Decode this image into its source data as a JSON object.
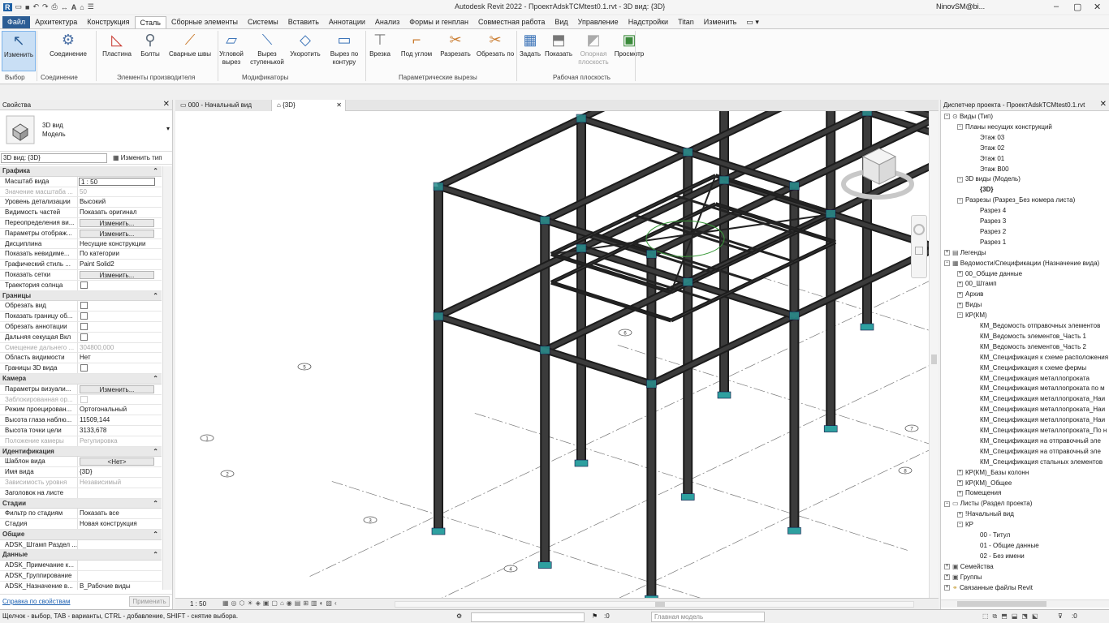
{
  "window": {
    "title": "Autodesk Revit 2022 - ПроектAdskTCMtest0.1.rvt - 3D вид: {3D}",
    "user": "NinovSM@bi..."
  },
  "tabs": [
    "Файл",
    "Архитектура",
    "Конструкция",
    "Сталь",
    "Сборные элементы",
    "Системы",
    "Вставить",
    "Аннотации",
    "Анализ",
    "Формы и генплан",
    "Совместная работа",
    "Вид",
    "Управление",
    "Надстройки",
    "Titan",
    "Изменить"
  ],
  "ribbon": {
    "buttons": [
      "Изменить",
      "Соединение",
      "Пластина",
      "Болты",
      "Сварные швы",
      "Угловой вырез",
      "Вырез ступенькой",
      "Укоротить",
      "Вырез по контуру",
      "Врезка",
      "Под углом",
      "Разрезать",
      "Обрезать по",
      "Задать",
      "Показать",
      "Опорная плоскость",
      "Просмотр"
    ],
    "panels": [
      "Выбор",
      "Соединение",
      "Элементы производителя",
      "Модификаторы",
      "Параметрические вырезы",
      "Рабочая плоскость"
    ]
  },
  "properties": {
    "title": "Свойства",
    "type_name": "3D вид",
    "type_family": "Модель",
    "selector": "3D вид: {3D}",
    "edit_type": "Изменить тип",
    "sections": [
      {
        "name": "Графика",
        "rows": [
          [
            "Масштаб вида",
            "1 : 50"
          ],
          [
            "Значение масштаба ...",
            "50"
          ],
          [
            "Уровень детализации",
            "Высокий"
          ],
          [
            "Видимость частей",
            "Показать оригинал"
          ],
          [
            "Переопределения ви...",
            "Изменить..."
          ],
          [
            "Параметры отображ...",
            "Изменить..."
          ],
          [
            "Дисциплина",
            "Несущие конструкции"
          ],
          [
            "Показать невидиме...",
            "По категории"
          ],
          [
            "Графический стиль ...",
            "Paint Solid2"
          ],
          [
            "Показать сетки",
            "Изменить..."
          ],
          [
            "Траектория солнца",
            ""
          ]
        ]
      },
      {
        "name": "Границы",
        "rows": [
          [
            "Обрезать вид",
            ""
          ],
          [
            "Показать границу об...",
            ""
          ],
          [
            "Обрезать аннотации",
            ""
          ],
          [
            "Дальняя секущая Вкл",
            ""
          ],
          [
            "Смещение дальнего ...",
            "304800,000"
          ],
          [
            "Область видимости",
            "Нет"
          ],
          [
            "Границы 3D вида",
            ""
          ]
        ]
      },
      {
        "name": "Камера",
        "rows": [
          [
            "Параметры визуали...",
            "Изменить..."
          ],
          [
            "Заблокированная ор...",
            ""
          ],
          [
            "Режим проецирован...",
            "Ортогональный"
          ],
          [
            "Высота глаза наблю...",
            "11509,144"
          ],
          [
            "Высота точки цели",
            "3133,678"
          ],
          [
            "Положение камеры",
            "Регулировка"
          ]
        ]
      },
      {
        "name": "Идентификация",
        "rows": [
          [
            "Шаблон вида",
            "<Нет>"
          ],
          [
            "Имя вида",
            "{3D}"
          ],
          [
            "Зависимость уровня",
            "Независимый"
          ],
          [
            "Заголовок на листе",
            ""
          ]
        ]
      },
      {
        "name": "Стадии",
        "rows": [
          [
            "Фильтр по стадиям",
            "Показать все"
          ],
          [
            "Стадия",
            "Новая конструкция"
          ]
        ]
      },
      {
        "name": "Общие",
        "rows": [
          [
            "ADSK_Штамп Раздел ...",
            ""
          ]
        ]
      },
      {
        "name": "Данные",
        "rows": [
          [
            "ADSK_Примечание к...",
            ""
          ],
          [
            "ADSK_Группирование",
            ""
          ],
          [
            "ADSK_Назначение в...",
            "В_Рабочие виды"
          ]
        ]
      }
    ],
    "help_link": "Справка по свойствам",
    "apply": "Применить"
  },
  "view_tabs": [
    "000 - Начальный вид",
    "{3D}"
  ],
  "view_scale": "1 : 50",
  "grid_labels": [
    "1",
    "2",
    "3",
    "4",
    "5",
    "6",
    "7",
    "8"
  ],
  "browser": {
    "title": "Диспетчер проекта - ПроектAdskTCMtest0.1.rvt",
    "items": [
      {
        "t": "Виды (Тип)",
        "l": 0
      },
      {
        "t": "Планы несущих конструкций",
        "l": 1
      },
      {
        "t": "Этаж 03",
        "l": 2
      },
      {
        "t": "Этаж 02",
        "l": 2
      },
      {
        "t": "Этаж 01",
        "l": 2
      },
      {
        "t": "Этаж В00",
        "l": 2
      },
      {
        "t": "3D виды (Модель)",
        "l": 1
      },
      {
        "t": "{3D}",
        "l": 2
      },
      {
        "t": "Разрезы (Разрез_Без номера листа)",
        "l": 1
      },
      {
        "t": "Разрез 4",
        "l": 2
      },
      {
        "t": "Разрез 3",
        "l": 2
      },
      {
        "t": "Разрез 2",
        "l": 2
      },
      {
        "t": "Разрез 1",
        "l": 2
      },
      {
        "t": "Легенды",
        "l": 0
      },
      {
        "t": "Ведомости/Спецификации (Назначение вида)",
        "l": 0
      },
      {
        "t": "00_Общие данные",
        "l": 1
      },
      {
        "t": "00_Штамп",
        "l": 1
      },
      {
        "t": "Архив",
        "l": 1
      },
      {
        "t": "Виды",
        "l": 1
      },
      {
        "t": "КР(КМ)",
        "l": 1
      },
      {
        "t": "КМ_Ведомость отправочных элементов",
        "l": 2
      },
      {
        "t": "КМ_Ведомость элементов_Часть 1",
        "l": 2
      },
      {
        "t": "КМ_Ведомость элементов_Часть 2",
        "l": 2
      },
      {
        "t": "КМ_Спецификация к схеме расположения",
        "l": 2
      },
      {
        "t": "КМ_Спецификация к схеме фермы",
        "l": 2
      },
      {
        "t": "КМ_Спецификация металлопроката",
        "l": 2
      },
      {
        "t": "КМ_Спецификация металлопроката по м",
        "l": 2
      },
      {
        "t": "КМ_Спецификация металлопроката_Наи",
        "l": 2
      },
      {
        "t": "КМ_Спецификация металлопроката_Наи",
        "l": 2
      },
      {
        "t": "КМ_Спецификация металлопроката_Наи",
        "l": 2
      },
      {
        "t": "КМ_Спецификация металлопроката_По н",
        "l": 2
      },
      {
        "t": "КМ_Спецификация на отправочный эле",
        "l": 2
      },
      {
        "t": "КМ_Спецификация на отправочный эле",
        "l": 2
      },
      {
        "t": "КМ_Спецификация стальных элементов",
        "l": 2
      },
      {
        "t": "КР(КМ)_Базы колонн",
        "l": 1
      },
      {
        "t": "КР(КМ)_Общее",
        "l": 1
      },
      {
        "t": "Помещения",
        "l": 1
      },
      {
        "t": "Листы (Раздел проекта)",
        "l": 0
      },
      {
        "t": "!Начальный вид",
        "l": 1
      },
      {
        "t": "КР",
        "l": 1
      },
      {
        "t": "00 - Титул",
        "l": 2
      },
      {
        "t": "01 - Общие данные",
        "l": 2
      },
      {
        "t": "02 - Без имени",
        "l": 2
      },
      {
        "t": "Семейства",
        "l": 0
      },
      {
        "t": "Группы",
        "l": 0
      },
      {
        "t": "Связанные файлы Revit",
        "l": 0
      }
    ]
  },
  "status": {
    "hint": "Щелчок - выбор, TAB - варианты, CTRL - добавление, SHIFT - снятие выбора.",
    "zero": ":0",
    "model": "Главная модель",
    "zero2": ":0"
  }
}
